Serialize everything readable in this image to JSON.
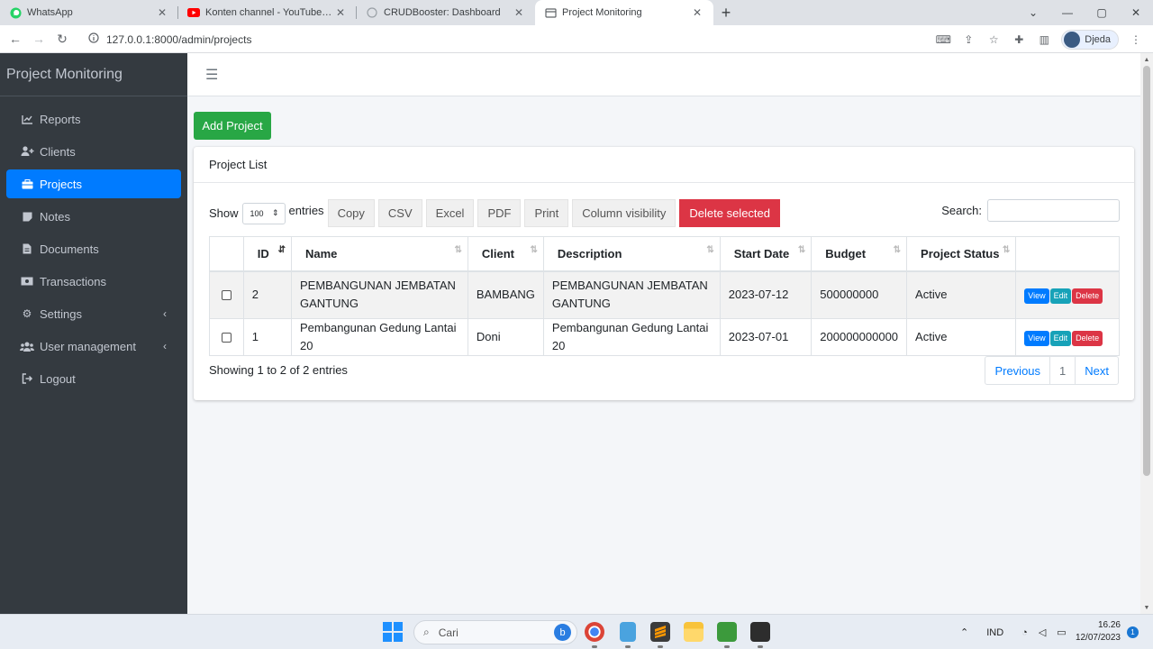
{
  "browser": {
    "tabs": [
      {
        "title": "WhatsApp",
        "active": false
      },
      {
        "title": "Konten channel - YouTube Studio",
        "active": false
      },
      {
        "title": "CRUDBooster: Dashboard",
        "active": false
      },
      {
        "title": "Project Monitoring",
        "active": true
      }
    ],
    "url": "127.0.0.1:8000/admin/projects",
    "profile_name": "Djeda"
  },
  "sidebar": {
    "brand": "Project Monitoring",
    "items": [
      {
        "label": "Reports",
        "icon": "chart-line-icon"
      },
      {
        "label": "Clients",
        "icon": "user-plus-icon"
      },
      {
        "label": "Projects",
        "icon": "briefcase-icon",
        "active": true
      },
      {
        "label": "Notes",
        "icon": "sticky-note-icon"
      },
      {
        "label": "Documents",
        "icon": "file-icon"
      },
      {
        "label": "Transactions",
        "icon": "money-bill-icon"
      },
      {
        "label": "Settings",
        "icon": "cog-icon",
        "submenu": true
      },
      {
        "label": "User management",
        "icon": "users-icon",
        "submenu": true
      },
      {
        "label": "Logout",
        "icon": "sign-out-icon"
      }
    ]
  },
  "main": {
    "add_button": "Add Project",
    "card_title": "Project List",
    "show_label": "Show",
    "page_length": "100",
    "entries_label": "entries",
    "export_buttons": [
      "Copy",
      "CSV",
      "Excel",
      "PDF",
      "Print",
      "Column visibility"
    ],
    "delete_selected": "Delete selected",
    "search_label": "Search:",
    "search_value": "",
    "columns": [
      "ID",
      "Name",
      "Client",
      "Description",
      "Start Date",
      "Budget",
      "Project Status"
    ],
    "rows": [
      {
        "id": "2",
        "name": "PEMBANGUNAN JEMBATAN GANTUNG",
        "client": "BAMBANG",
        "description": "PEMBANGUNAN JEMBATAN GANTUNG",
        "start_date": "2023-07-12",
        "budget": "500000000",
        "status": "Active"
      },
      {
        "id": "1",
        "name": "Pembangunan Gedung Lantai 20",
        "client": "Doni",
        "description": "Pembangunan Gedung Lantai 20",
        "start_date": "2023-07-01",
        "budget": "200000000000",
        "status": "Active"
      }
    ],
    "row_actions": {
      "view": "View",
      "edit": "Edit",
      "delete": "Delete"
    },
    "info": "Showing 1 to 2 of 2 entries",
    "pagination": {
      "previous": "Previous",
      "current": "1",
      "next": "Next"
    }
  },
  "taskbar": {
    "search_placeholder": "Cari",
    "language": "IND",
    "time": "16.26",
    "date": "12/07/2023",
    "notifications": "1"
  },
  "colors": {
    "sidebar_bg": "#343a40",
    "primary": "#007bff",
    "success": "#28a745",
    "danger": "#dc3545",
    "info": "#17a2b8"
  }
}
